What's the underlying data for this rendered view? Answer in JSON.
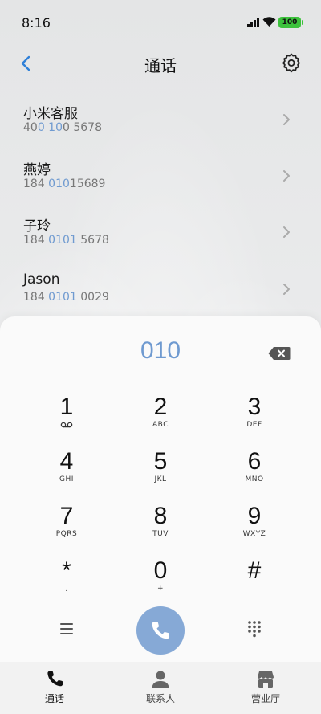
{
  "status": {
    "time": "8:16",
    "battery": "100",
    "battery_color": "#3cc23c"
  },
  "header": {
    "title": "通话",
    "back_icon": "chevron-left-icon",
    "settings_icon": "gear-icon"
  },
  "contacts": [
    {
      "name": "小米客服",
      "num_pre": "40",
      "num_hl": "0 10",
      "num_post": "0 5678"
    },
    {
      "name": "燕婷",
      "num_pre": "184 ",
      "num_hl": "010",
      "num_post": "15689"
    },
    {
      "name": "子玲",
      "num_pre": "184 ",
      "num_hl": "0101",
      "num_post": " 5678"
    },
    {
      "name": "Jason",
      "num_pre": "184 ",
      "num_hl": "0101",
      "num_post": " 0029"
    }
  ],
  "dialpad": {
    "input_value": "010",
    "accent_color": "#6f9ad0",
    "keys": [
      {
        "digit": "1",
        "sub": ""
      },
      {
        "digit": "2",
        "sub": "ABC"
      },
      {
        "digit": "3",
        "sub": "DEF"
      },
      {
        "digit": "4",
        "sub": "GHI"
      },
      {
        "digit": "5",
        "sub": "JKL"
      },
      {
        "digit": "6",
        "sub": "MNO"
      },
      {
        "digit": "7",
        "sub": "PQRS"
      },
      {
        "digit": "8",
        "sub": "TUV"
      },
      {
        "digit": "9",
        "sub": "WXYZ"
      },
      {
        "digit": "*",
        "sub": ","
      },
      {
        "digit": "0",
        "sub": "+"
      },
      {
        "digit": "#",
        "sub": ""
      }
    ]
  },
  "bottom_nav": {
    "items": [
      {
        "label": "通话",
        "icon": "phone-icon",
        "active": true
      },
      {
        "label": "联系人",
        "icon": "person-icon",
        "active": false
      },
      {
        "label": "营业厅",
        "icon": "store-icon",
        "active": false
      }
    ]
  }
}
